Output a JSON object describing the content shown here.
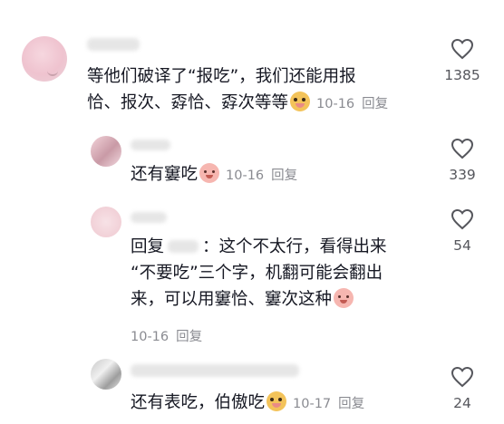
{
  "comments": [
    {
      "line1": "等他们破译了“报吃”，我们还能用报",
      "line2": "恰、报次、孬恰、孬次等等",
      "date": "10-16",
      "reply_label": "回复",
      "likes": "1385"
    },
    {
      "text": "还有窶吃",
      "date": "10-16",
      "reply_label": "回复",
      "likes": "339"
    },
    {
      "reply_prefix": "回复",
      "line1_rest": "：这个不太行，看得出来",
      "line2": "“不要吃”三个字，机翻可能会翻出",
      "line3": "来，可以用窶恰、窶次这种",
      "date": "10-16",
      "reply_label": "回复",
      "likes": "54"
    },
    {
      "text": "还有表吃，伯傲吃",
      "date": "10-17",
      "reply_label": "回复",
      "likes": "24"
    }
  ],
  "icons": [
    "heart-icon",
    "doge-emoji-icon",
    "shy-emoji-icon"
  ]
}
